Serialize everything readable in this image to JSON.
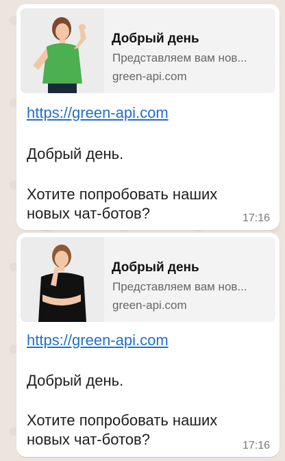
{
  "messages": [
    {
      "preview": {
        "title": "Добрый день",
        "description": "Представляем вам нов...",
        "domain": "green-api.com",
        "shirt_color": "#4caf50"
      },
      "link": "https://green-api.com",
      "greeting": "Добрый день.",
      "body_line1": "Хотите попробовать наших",
      "body_line2": "новых чат-ботов?",
      "time": "17:16"
    },
    {
      "preview": {
        "title": "Добрый день",
        "description": "Представляем вам нов...",
        "domain": "green-api.com",
        "shirt_color": "#111111"
      },
      "link": "https://green-api.com",
      "greeting": "Добрый день.",
      "body_line1": "Хотите попробовать наших",
      "body_line2": "новых чат-ботов?",
      "time": "17:16"
    }
  ],
  "colors": {
    "chat_background": "#ece5dd",
    "bubble": "#ffffff",
    "link": "#1f6fcb"
  }
}
